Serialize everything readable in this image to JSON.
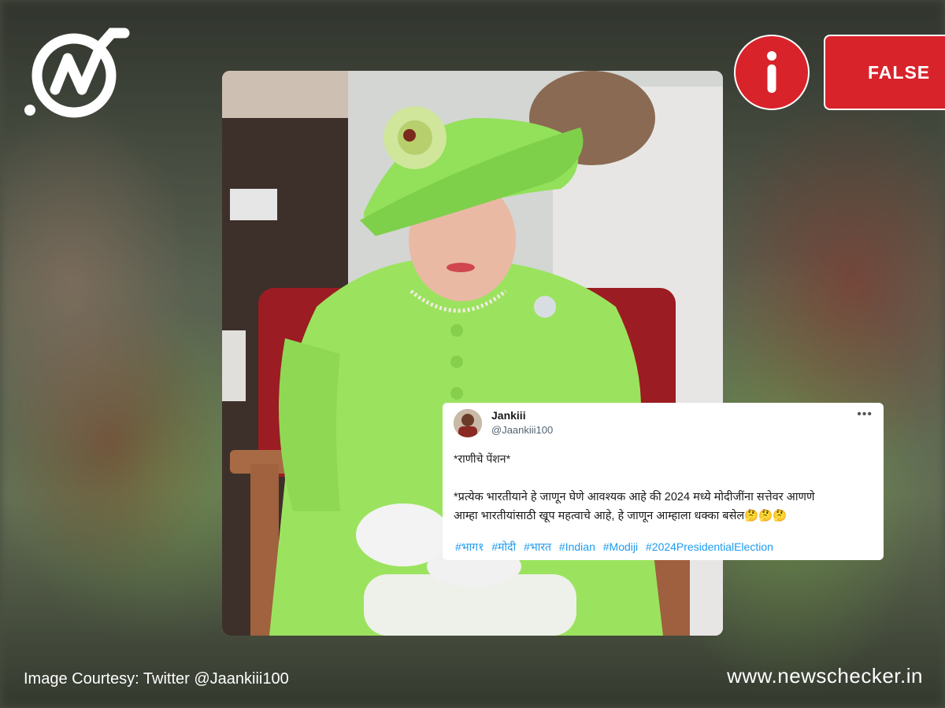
{
  "verdict": {
    "label": "FALSE",
    "color": "#d9232b"
  },
  "icons": {
    "logo": "newschecker-logo",
    "info": "info-icon",
    "more": "more-options-icon"
  },
  "tweet": {
    "display_name": "Jankiii",
    "handle": "@Jaankiii100",
    "more": "•••",
    "line1": "*राणीचे पेंशन*",
    "line2a": "*प्रत्येक भारतीयाने हे जाणून घेणे आवश्यक आहे की 2024 मध्ये मोदीजींना सत्तेवर आणणे",
    "line2b": "आम्हा भारतीयांसाठी खूप महत्वाचे आहे, हे जाणून आम्हाला धक्का बसेल🤔🤔🤔",
    "hashtags": [
      "#भाग१",
      "#मोदी",
      "#भारत",
      "#Indian",
      "#Modiji",
      "#2024PresidentialElection"
    ]
  },
  "footer": {
    "credit": "Image Courtesy: Twitter @Jaankiii100",
    "site": "www.newschecker.in"
  }
}
